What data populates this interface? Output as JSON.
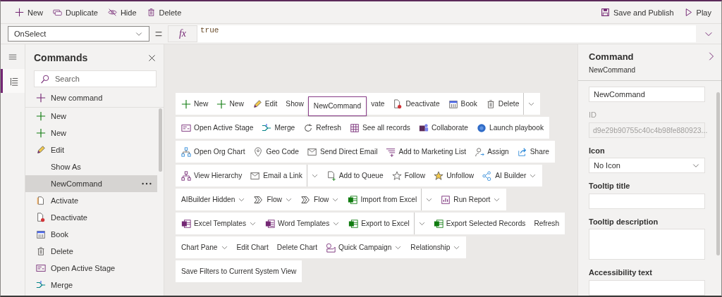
{
  "toolbar": {
    "left": [
      {
        "label": "New"
      },
      {
        "label": "Duplicate"
      },
      {
        "label": "Hide"
      },
      {
        "label": "Delete"
      }
    ],
    "right": [
      {
        "label": "Save and Publish"
      },
      {
        "label": "Play"
      }
    ]
  },
  "formula_bar": {
    "property": "OnSelect",
    "operator": "=",
    "fx_label": "fx",
    "formula": "true"
  },
  "rail_items": [
    {
      "selected": true
    }
  ],
  "commands_panel": {
    "title": "Commands",
    "search_placeholder": "Search",
    "new_command": "New command",
    "items": [
      {
        "label": "New",
        "selected": false
      },
      {
        "label": "New",
        "selected": false
      },
      {
        "label": "Edit",
        "selected": false
      },
      {
        "label": "Show As",
        "selected": false
      },
      {
        "label": "NewCommand",
        "selected": true
      },
      {
        "label": "Activate",
        "selected": false
      },
      {
        "label": "Deactivate",
        "selected": false
      },
      {
        "label": "Book",
        "selected": false
      },
      {
        "label": "Delete",
        "selected": false
      },
      {
        "label": "Open Active Stage",
        "selected": false
      },
      {
        "label": "Merge",
        "selected": false
      }
    ]
  },
  "command_bar": {
    "rows": [
      {
        "items": [
          {
            "kind": "button",
            "label": "New",
            "chevron": false
          },
          {
            "kind": "button",
            "label": "New",
            "chevron": false
          },
          {
            "kind": "button",
            "label": "Edit",
            "chevron": false
          },
          {
            "kind": "button",
            "label": "Show",
            "chevron": false
          },
          {
            "kind": "tooltip",
            "label": "NewCommand"
          },
          {
            "kind": "button",
            "label": "vate",
            "chevron": false
          },
          {
            "kind": "button",
            "label": "Deactivate",
            "chevron": false
          },
          {
            "kind": "button",
            "label": "Book",
            "chevron": false
          },
          {
            "kind": "button",
            "label": "Delete",
            "chevron": false
          },
          {
            "kind": "split"
          }
        ]
      },
      {
        "items": [
          {
            "kind": "button",
            "label": "Open Active Stage",
            "chevron": false
          },
          {
            "kind": "button",
            "label": "Merge",
            "chevron": false
          },
          {
            "kind": "button",
            "label": "Refresh",
            "chevron": false
          },
          {
            "kind": "button",
            "label": "See all records",
            "chevron": false
          },
          {
            "kind": "button",
            "label": "Collaborate",
            "chevron": false
          },
          {
            "kind": "button",
            "label": "Launch playbook",
            "chevron": false
          }
        ]
      },
      {
        "items": [
          {
            "kind": "button",
            "label": "Open Org Chart",
            "chevron": false
          },
          {
            "kind": "button",
            "label": "Geo Code",
            "chevron": false
          },
          {
            "kind": "button",
            "label": "Send Direct Email",
            "chevron": false
          },
          {
            "kind": "button",
            "label": "Add to Marketing List",
            "chevron": false
          },
          {
            "kind": "button",
            "label": "Assign",
            "chevron": false
          },
          {
            "kind": "button",
            "label": "Share",
            "chevron": false
          }
        ]
      },
      {
        "items": [
          {
            "kind": "button",
            "label": "View Hierarchy",
            "chevron": false
          },
          {
            "kind": "button",
            "label": "Email a Link",
            "chevron": false
          },
          {
            "kind": "split"
          },
          {
            "kind": "button",
            "label": "Add to Queue",
            "chevron": false
          },
          {
            "kind": "button",
            "label": "Follow",
            "chevron": false
          },
          {
            "kind": "button",
            "label": "Unfollow",
            "chevron": false
          },
          {
            "kind": "button",
            "label": "AI Builder",
            "chevron": true
          }
        ]
      },
      {
        "items": [
          {
            "kind": "button",
            "label": "AIBuilder Hidden",
            "chevron": true
          },
          {
            "kind": "button",
            "label": "Flow",
            "chevron": true
          },
          {
            "kind": "button",
            "label": "Flow",
            "chevron": true
          },
          {
            "kind": "button",
            "label": "Import from Excel",
            "chevron": false
          },
          {
            "kind": "split"
          },
          {
            "kind": "button",
            "label": "Run Report",
            "chevron": true
          }
        ]
      },
      {
        "items": [
          {
            "kind": "button",
            "label": "Excel Templates",
            "chevron": true
          },
          {
            "kind": "button",
            "label": "Word Templates",
            "chevron": true
          },
          {
            "kind": "button",
            "label": "Export to Excel",
            "chevron": false
          },
          {
            "kind": "split"
          },
          {
            "kind": "button",
            "label": "Export Selected Records",
            "chevron": false
          },
          {
            "kind": "button",
            "label": "Refresh",
            "chevron": false
          }
        ]
      },
      {
        "items": [
          {
            "kind": "button",
            "label": "Chart Pane",
            "chevron": true
          },
          {
            "kind": "button",
            "label": "Edit Chart",
            "chevron": false
          },
          {
            "kind": "button",
            "label": "Delete Chart",
            "chevron": false
          },
          {
            "kind": "button",
            "label": "Quick Campaign",
            "chevron": true
          },
          {
            "kind": "button",
            "label": "Relationship",
            "chevron": true
          }
        ]
      },
      {
        "items": [
          {
            "kind": "button",
            "label": "Save Filters to Current System View",
            "chevron": false
          }
        ]
      }
    ]
  },
  "properties_panel": {
    "title": "Command",
    "subtitle": "NewCommand",
    "fields": [
      {
        "kind": "text",
        "value": "NewCommand",
        "disabled": false
      },
      {
        "kind": "text",
        "label": "ID",
        "value": "d9e29b90755c40c4b98fe880923...",
        "disabled": true
      },
      {
        "kind": "select",
        "label": "Icon",
        "value": "No Icon",
        "disabled": false
      },
      {
        "kind": "text",
        "label": "Tooltip title",
        "disabled": false
      },
      {
        "kind": "textarea",
        "label": "Tooltip description",
        "disabled": false
      },
      {
        "kind": "text",
        "label": "Accessibility text",
        "disabled": false
      }
    ]
  }
}
